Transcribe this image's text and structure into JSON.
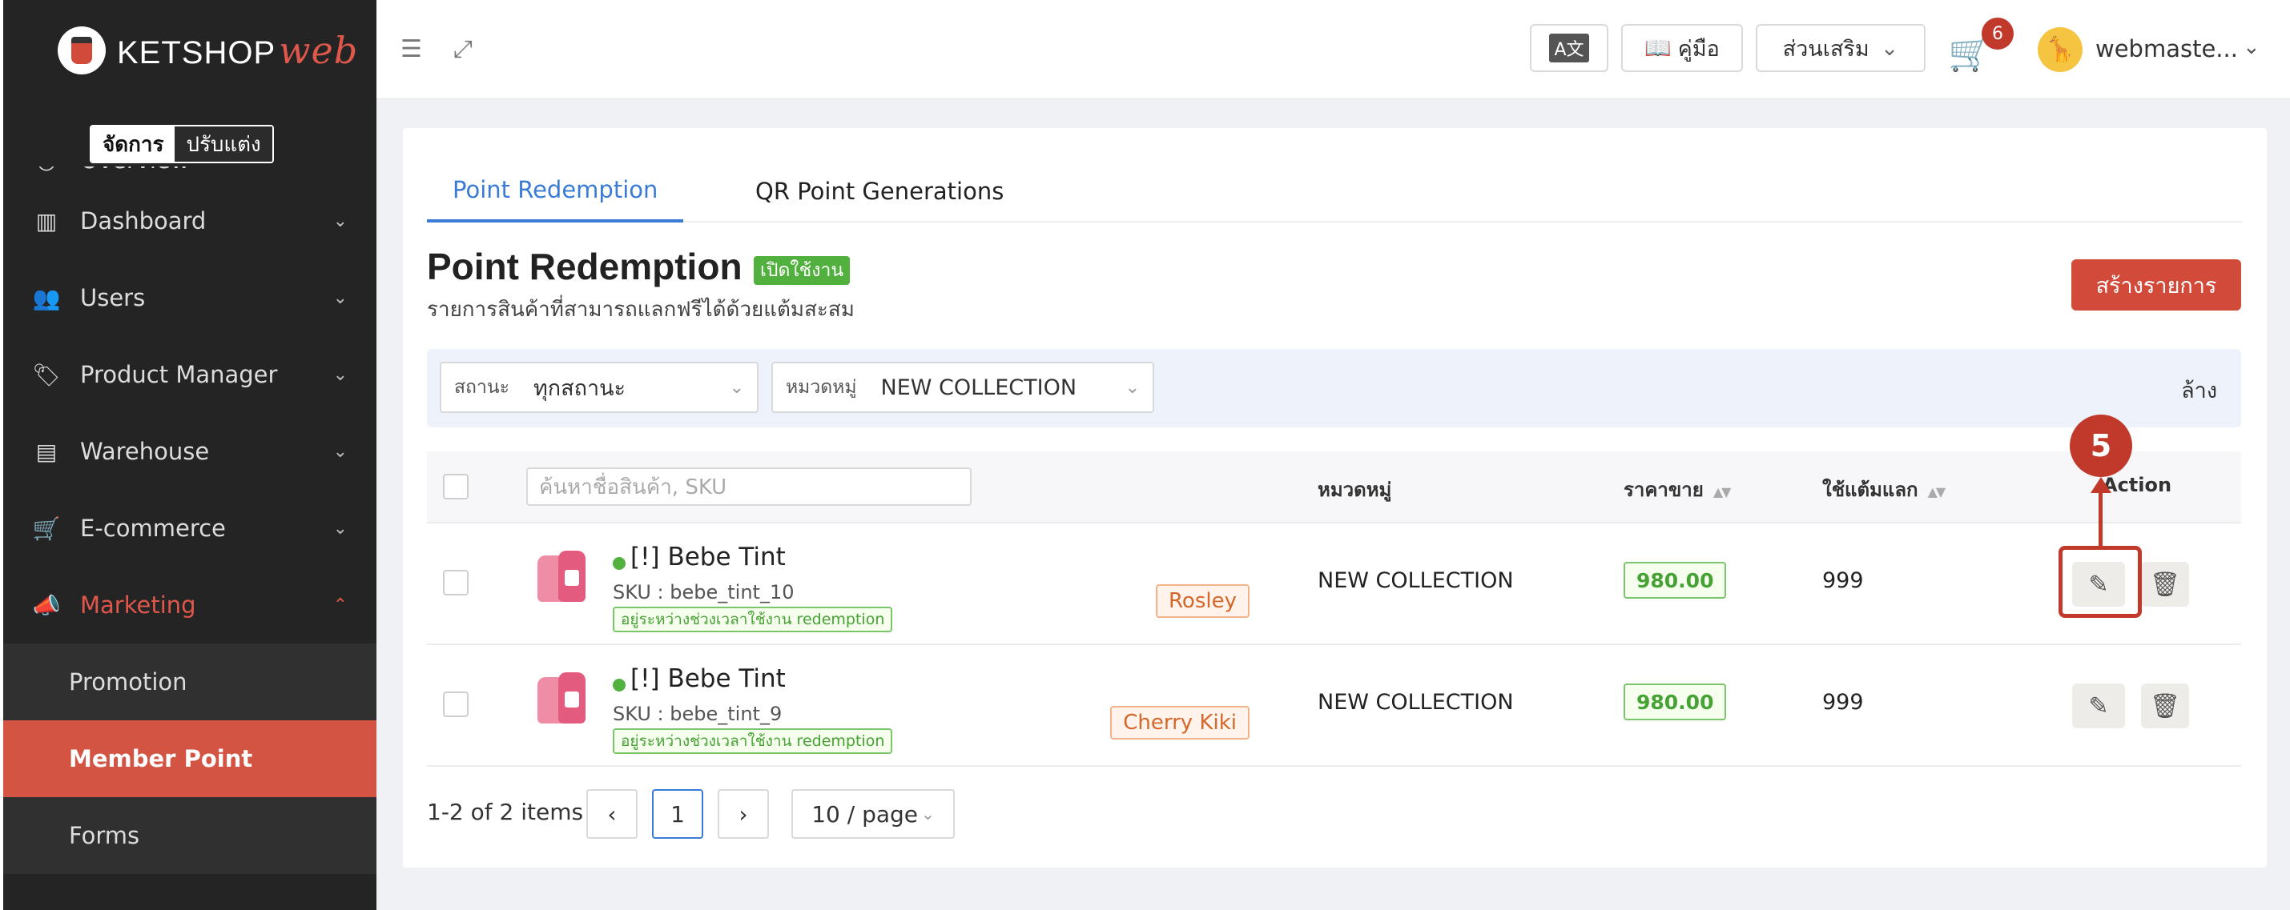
{
  "brand": {
    "name": "KETSHOP",
    "suffix": "web"
  },
  "mode_switch": {
    "manage": "จัดการ",
    "customize": "ปรับแต่ง"
  },
  "sidebar": {
    "clipped_item": "Overview",
    "items": [
      {
        "label": "Dashboard",
        "icon": "chart-icon"
      },
      {
        "label": "Users",
        "icon": "users-icon"
      },
      {
        "label": "Product Manager",
        "icon": "tag-icon"
      },
      {
        "label": "Warehouse",
        "icon": "warehouse-icon"
      },
      {
        "label": "E-commerce",
        "icon": "cart-icon"
      },
      {
        "label": "Marketing",
        "icon": "megaphone-icon"
      }
    ],
    "sub_items": [
      "Promotion",
      "Member Point",
      "Forms"
    ]
  },
  "topbar": {
    "guide": "คู่มือ",
    "addons": "ส่วนเสริม",
    "cart_count": "6",
    "username": "webmaste..."
  },
  "tabs": [
    "Point Redemption",
    "QR Point Generations"
  ],
  "page": {
    "title": "Point Redemption",
    "status": "เปิดใช้งาน",
    "subtitle": "รายการสินค้าที่สามารถแลกฟรีได้ด้วยแต้มสะสม",
    "create_button": "สร้างรายการ"
  },
  "filters": {
    "status_label": "สถานะ",
    "status_value": "ทุกสถานะ",
    "category_label": "หมวดหมู่",
    "category_value": "NEW COLLECTION",
    "clear": "ล้าง"
  },
  "table": {
    "search_placeholder": "ค้นหาชื่อสินค้า, SKU",
    "columns": {
      "category": "หมวดหมู่",
      "price": "ราคาขาย",
      "points": "ใช้แต้มแลก",
      "action": "Action"
    },
    "rows": [
      {
        "name": "[!] Bebe Tint",
        "sku": "SKU : bebe_tint_10",
        "note": "อยู่ระหว่างช่วงเวลาใช้งาน redemption",
        "variant": "Rosley",
        "category": "NEW COLLECTION",
        "price": "980.00",
        "points": "999"
      },
      {
        "name": "[!] Bebe Tint",
        "sku": "SKU : bebe_tint_9",
        "note": "อยู่ระหว่างช่วงเวลาใช้งาน redemption",
        "variant": "Cherry Kiki",
        "category": "NEW COLLECTION",
        "price": "980.00",
        "points": "999"
      }
    ]
  },
  "pagination": {
    "summary": "1-2 of 2 items",
    "current": "1",
    "page_size": "10 / page"
  },
  "annotation": {
    "step": "5"
  },
  "colors": {
    "accent": "#d14a3a",
    "link": "#3a7bd5",
    "success": "#52b03e",
    "sidebar": "#242424"
  }
}
